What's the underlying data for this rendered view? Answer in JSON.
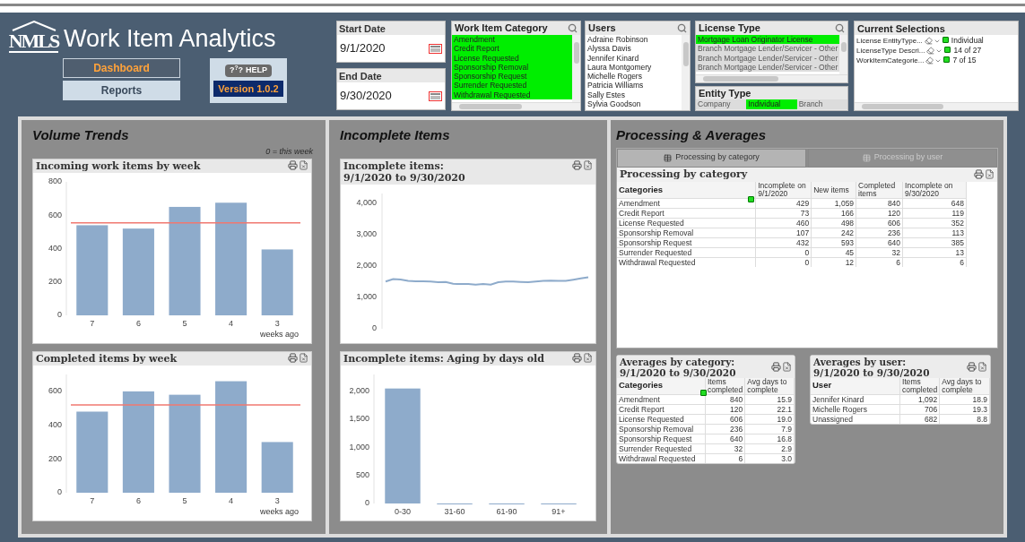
{
  "header": {
    "logo_text": "NMLS",
    "title": "Work Item Analytics",
    "nav": [
      {
        "label": "Dashboard",
        "selected": true
      },
      {
        "label": "Reports",
        "selected": false
      }
    ],
    "help_button": {
      "glyph": "?$^{?}$?",
      "label": "HELP"
    },
    "version": "Version 1.0.2"
  },
  "dates": [
    {
      "label": "Start Date",
      "value": "9/1/2020"
    },
    {
      "label": "End Date",
      "value": "9/30/2020"
    }
  ],
  "work_item_category": {
    "title": "Work Item Category",
    "items": [
      {
        "label": "Amendment",
        "selected": true
      },
      {
        "label": "Credit Report",
        "selected": true
      },
      {
        "label": "License Requested",
        "selected": true
      },
      {
        "label": "Sponsorship Removal",
        "selected": true
      },
      {
        "label": "Sponsorship Request",
        "selected": true
      },
      {
        "label": "Surrender Requested",
        "selected": true
      },
      {
        "label": "Withdrawal Requested",
        "selected": true
      }
    ]
  },
  "users": {
    "title": "Users",
    "items": [
      {
        "label": "Adraine Robinson",
        "selected": false
      },
      {
        "label": "Alyssa Davis",
        "selected": false
      },
      {
        "label": "Jennifer Kinard",
        "selected": false
      },
      {
        "label": "Laura Montgomery",
        "selected": false
      },
      {
        "label": "Michelle Rogers",
        "selected": false
      },
      {
        "label": "Patricia Williams",
        "selected": false
      },
      {
        "label": "Sally Estes",
        "selected": false
      },
      {
        "label": "Sylvia Goodson",
        "selected": false
      }
    ]
  },
  "license_type": {
    "title": "License Type",
    "items": [
      {
        "label": "Mortgage Loan Originator License",
        "selected": true,
        "excluded": false
      },
      {
        "label": "Branch Mortgage Lender/Servicer - Other",
        "selected": false,
        "excluded": true
      },
      {
        "label": "Branch Mortgage Lender/Servicer - Other",
        "selected": false,
        "excluded": true
      },
      {
        "label": "Branch Mortgage Lender/Servicer - Other",
        "selected": false,
        "excluded": true
      }
    ]
  },
  "entity_type": {
    "title": "Entity Type",
    "items": [
      {
        "label": "Company",
        "selected": false,
        "excluded": true
      },
      {
        "label": "Individual",
        "selected": true,
        "excluded": false
      },
      {
        "label": "Branch",
        "selected": false,
        "excluded": true
      }
    ]
  },
  "current_selections": {
    "title": "Current Selections",
    "rows": [
      {
        "field": "License EntityType...",
        "value": "Individual"
      },
      {
        "field": "LicenseType Descri...",
        "value": "14 of 27"
      },
      {
        "field": "WorkItemCategorie...",
        "value": "7 of 15"
      }
    ]
  },
  "volume_trends": {
    "title": "Volume Trends",
    "note": "0 = this week",
    "charts": [
      {
        "title": "Incoming work items by week",
        "chart_data": {
          "type": "bar",
          "categories": [
            "7",
            "6",
            "5",
            "4",
            "3"
          ],
          "xlabel": "weeks ago",
          "values": [
            540,
            520,
            650,
            675,
            395
          ],
          "ylim": [
            0,
            800
          ],
          "yticks": [
            0,
            200,
            400,
            600,
            800
          ],
          "ref_lines": [
            {
              "axis": "y",
              "value": 555
            }
          ]
        }
      },
      {
        "title": "Completed items by week",
        "chart_data": {
          "type": "bar",
          "categories": [
            "7",
            "6",
            "5",
            "4",
            "3"
          ],
          "xlabel": "weeks ago",
          "values": [
            480,
            600,
            580,
            660,
            300
          ],
          "ylim": [
            0,
            700
          ],
          "yticks": [
            0,
            200,
            400,
            600
          ],
          "ref_lines": [
            {
              "axis": "y",
              "value": 520
            }
          ]
        }
      }
    ]
  },
  "incomplete_items": {
    "title": "Incomplete Items",
    "charts": [
      {
        "title": "Incomplete items:",
        "subtitle": "9/1/2020 to 9/30/2020",
        "chart_data": {
          "type": "line",
          "categories": [
            null,
            null,
            null,
            null,
            null,
            null,
            null,
            null,
            null,
            null,
            null,
            null,
            null,
            null,
            null,
            null,
            null,
            null,
            null,
            null,
            null,
            null,
            null,
            null,
            null,
            null,
            null,
            null
          ],
          "series": [
            {
              "color": "#8eabcb",
              "values": [
                1500,
                1580,
                1570,
                1520,
                1510,
                1510,
                1500,
                1480,
                1490,
                1430,
                1420,
                1420,
                1400,
                1420,
                1400,
                1480,
                1500,
                1500,
                1490,
                1480,
                1500,
                1520,
                1530,
                1520,
                1520,
                1560,
                1600,
                1640
              ]
            }
          ],
          "ylim": [
            0,
            4300
          ],
          "yticks": [
            {
              "value": 0,
              "label": "0"
            },
            {
              "value": 1000,
              "label": "1,000"
            },
            {
              "value": 2000,
              "label": "2,000"
            },
            {
              "value": 3000,
              "label": "3,000"
            },
            {
              "value": 4000,
              "label": "4,000"
            }
          ]
        }
      },
      {
        "title": "Incomplete items: Aging by days old",
        "chart_data": {
          "type": "bar",
          "categories": [
            "0-30",
            "31-60",
            "61-90",
            "91+"
          ],
          "values": [
            2050,
            0,
            0,
            0
          ],
          "ylim": [
            0,
            2300
          ],
          "yticks": [
            {
              "value": 0,
              "label": "0"
            },
            {
              "value": 500,
              "label": "500"
            },
            {
              "value": 1000,
              "label": "1,000"
            },
            {
              "value": 1500,
              "label": "1,500"
            },
            {
              "value": 2000,
              "label": "2,000"
            }
          ]
        }
      }
    ]
  },
  "processing": {
    "title": "Processing & Averages",
    "tabs": [
      {
        "label": "Processing by category",
        "selected": true
      },
      {
        "label": "Processing by user",
        "selected": false
      }
    ],
    "table": {
      "title": "Processing by category",
      "columns": [
        "Categories",
        "Incomplete on 9/1/2020",
        "New items",
        "Completed items",
        "Incomplete on 9/30/2020"
      ],
      "rows": [
        [
          "Amendment",
          "429",
          "1,059",
          "840",
          "648"
        ],
        [
          "Credit Report",
          "73",
          "166",
          "120",
          "119"
        ],
        [
          "License Requested",
          "460",
          "498",
          "606",
          "352"
        ],
        [
          "Sponsorship Removal",
          "107",
          "242",
          "236",
          "113"
        ],
        [
          "Sponsorship Request",
          "432",
          "593",
          "640",
          "385"
        ],
        [
          "Surrender Requested",
          "0",
          "45",
          "32",
          "13"
        ],
        [
          "Withdrawal Requested",
          "0",
          "12",
          "6",
          "6"
        ]
      ]
    },
    "averages_by_category": {
      "title": "Averages by category:",
      "subtitle": "9/1/2020 to 9/30/2020",
      "columns": [
        "Categories",
        "Items completed",
        "Avg days to complete"
      ],
      "rows": [
        [
          "Amendment",
          "840",
          "15.9"
        ],
        [
          "Credit Report",
          "120",
          "22.1"
        ],
        [
          "License Requested",
          "606",
          "19.0"
        ],
        [
          "Sponsorship Removal",
          "236",
          "7.9"
        ],
        [
          "Sponsorship Request",
          "640",
          "16.8"
        ],
        [
          "Surrender Requested",
          "32",
          "2.9"
        ],
        [
          "Withdrawal Requested",
          "6",
          "3.0"
        ]
      ]
    },
    "averages_by_user": {
      "title": "Averages by user:",
      "subtitle": "9/1/2020 to 9/30/2020",
      "columns": [
        "User",
        "Items completed",
        "Avg days to complete"
      ],
      "rows": [
        [
          "Jennifer Kinard",
          "1,092",
          "18.9"
        ],
        [
          "Michelle Rogers",
          "706",
          "19.3"
        ],
        [
          "Unassigned",
          "682",
          "8.8"
        ]
      ]
    }
  }
}
